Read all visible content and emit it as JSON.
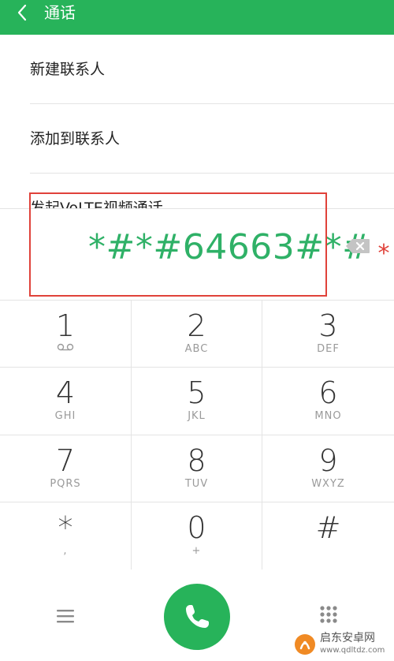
{
  "header": {
    "title": "通话",
    "background_color": "#27b35a"
  },
  "menu": {
    "items": [
      {
        "label": "新建联系人"
      },
      {
        "label": "添加到联系人"
      },
      {
        "label": "发起VoLTE视频通话"
      }
    ]
  },
  "dialer": {
    "number": "*#*#64663#*#",
    "trailing_mark": "*",
    "number_color": "#2fb167",
    "highlight_color": "#e0423a"
  },
  "keypad": {
    "keys": [
      {
        "digit": "1",
        "letters": "",
        "icon": "voicemail-icon"
      },
      {
        "digit": "2",
        "letters": "ABC"
      },
      {
        "digit": "3",
        "letters": "DEF"
      },
      {
        "digit": "4",
        "letters": "GHI"
      },
      {
        "digit": "5",
        "letters": "JKL"
      },
      {
        "digit": "6",
        "letters": "MNO"
      },
      {
        "digit": "7",
        "letters": "PQRS"
      },
      {
        "digit": "8",
        "letters": "TUV"
      },
      {
        "digit": "9",
        "letters": "WXYZ"
      },
      {
        "digit": "*",
        "letters": ","
      },
      {
        "digit": "0",
        "letters": "+"
      },
      {
        "digit": "#",
        "letters": ""
      }
    ]
  },
  "bottom_bar": {
    "left_icon": "menu-icon",
    "center_icon": "phone-icon",
    "right_icon": "keypad-grid-icon",
    "call_color": "#27b35a"
  },
  "watermark": {
    "text": "启东安卓网",
    "url": "www.qdltdz.com"
  }
}
